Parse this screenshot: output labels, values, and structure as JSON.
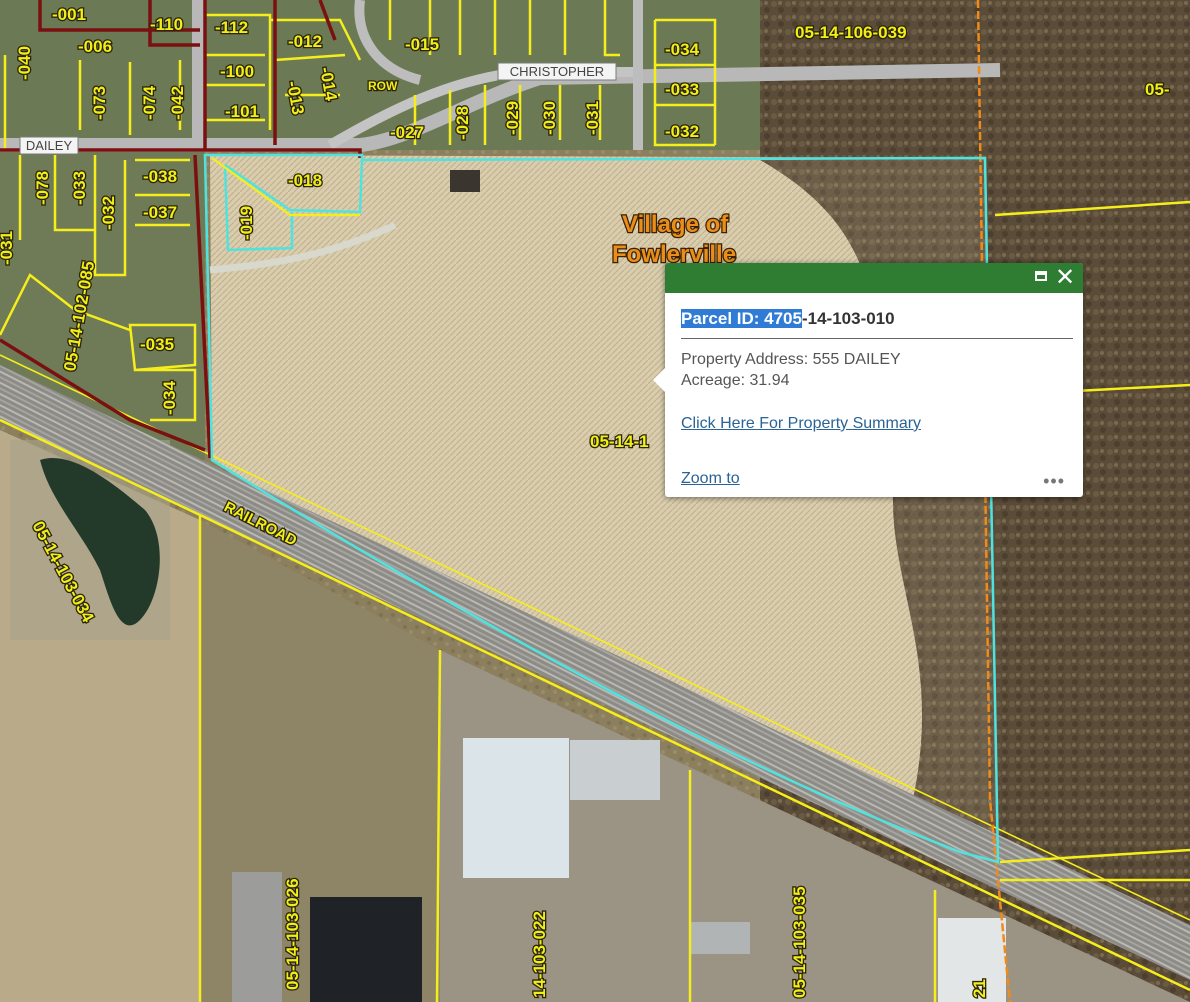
{
  "map": {
    "streets": {
      "christopher": "CHRISTOPHER",
      "dailey": "DAILEY",
      "row": "ROW",
      "railroad": "RAILROAD"
    },
    "village_label": [
      "Village of",
      "Fowlerville"
    ],
    "parcel_labels": {
      "p001": "-001",
      "p006": "-006",
      "p110": "-110",
      "p112": "-112",
      "p100": "-100",
      "p101": "-101",
      "p012": "-012",
      "p015": "-015",
      "p013": "-013",
      "p014": "-014",
      "p040": "-040",
      "p073": "-073",
      "p074": "-074",
      "p042": "-042",
      "p027": "-027",
      "p028": "-028",
      "p029": "-029",
      "p030": "-030",
      "p031": "-031",
      "p034top": "-034",
      "p033top": "-033",
      "p032top": "-032",
      "p106_039": "05-14-106-039",
      "p05_right": "05-",
      "p078": "-078",
      "p033": "-033",
      "p032": "-032",
      "p038": "-038",
      "p037": "-037",
      "p018": "-018",
      "p019": "-019",
      "p102_085": "05-14-102-085",
      "p035": "-035",
      "p034": "-034",
      "p031left": "-031",
      "p103_034": "05-14-103-034",
      "p103_026": "05-14-103-026",
      "p103_022": "14-103-022",
      "p103_035": "05-14-103-035",
      "p103_partial": "05-14-1",
      "p21": "21"
    }
  },
  "popup": {
    "title_highlight": "Parcel ID: 4705",
    "title_rest": "-14-103-010",
    "address": "Property Address: 555 DAILEY",
    "acreage": "Acreage: 31.94",
    "summary_link": "Click Here For Property Summary",
    "zoom_link": "Zoom to",
    "more": "•••",
    "close_glyph": "✕"
  },
  "colors": {
    "parcel_line": "#f5ee1a",
    "village_boundary": "#7a1010",
    "selected_parcel": "#4fe3e0",
    "popup_header": "#2e7d32",
    "link": "#2a6496"
  }
}
